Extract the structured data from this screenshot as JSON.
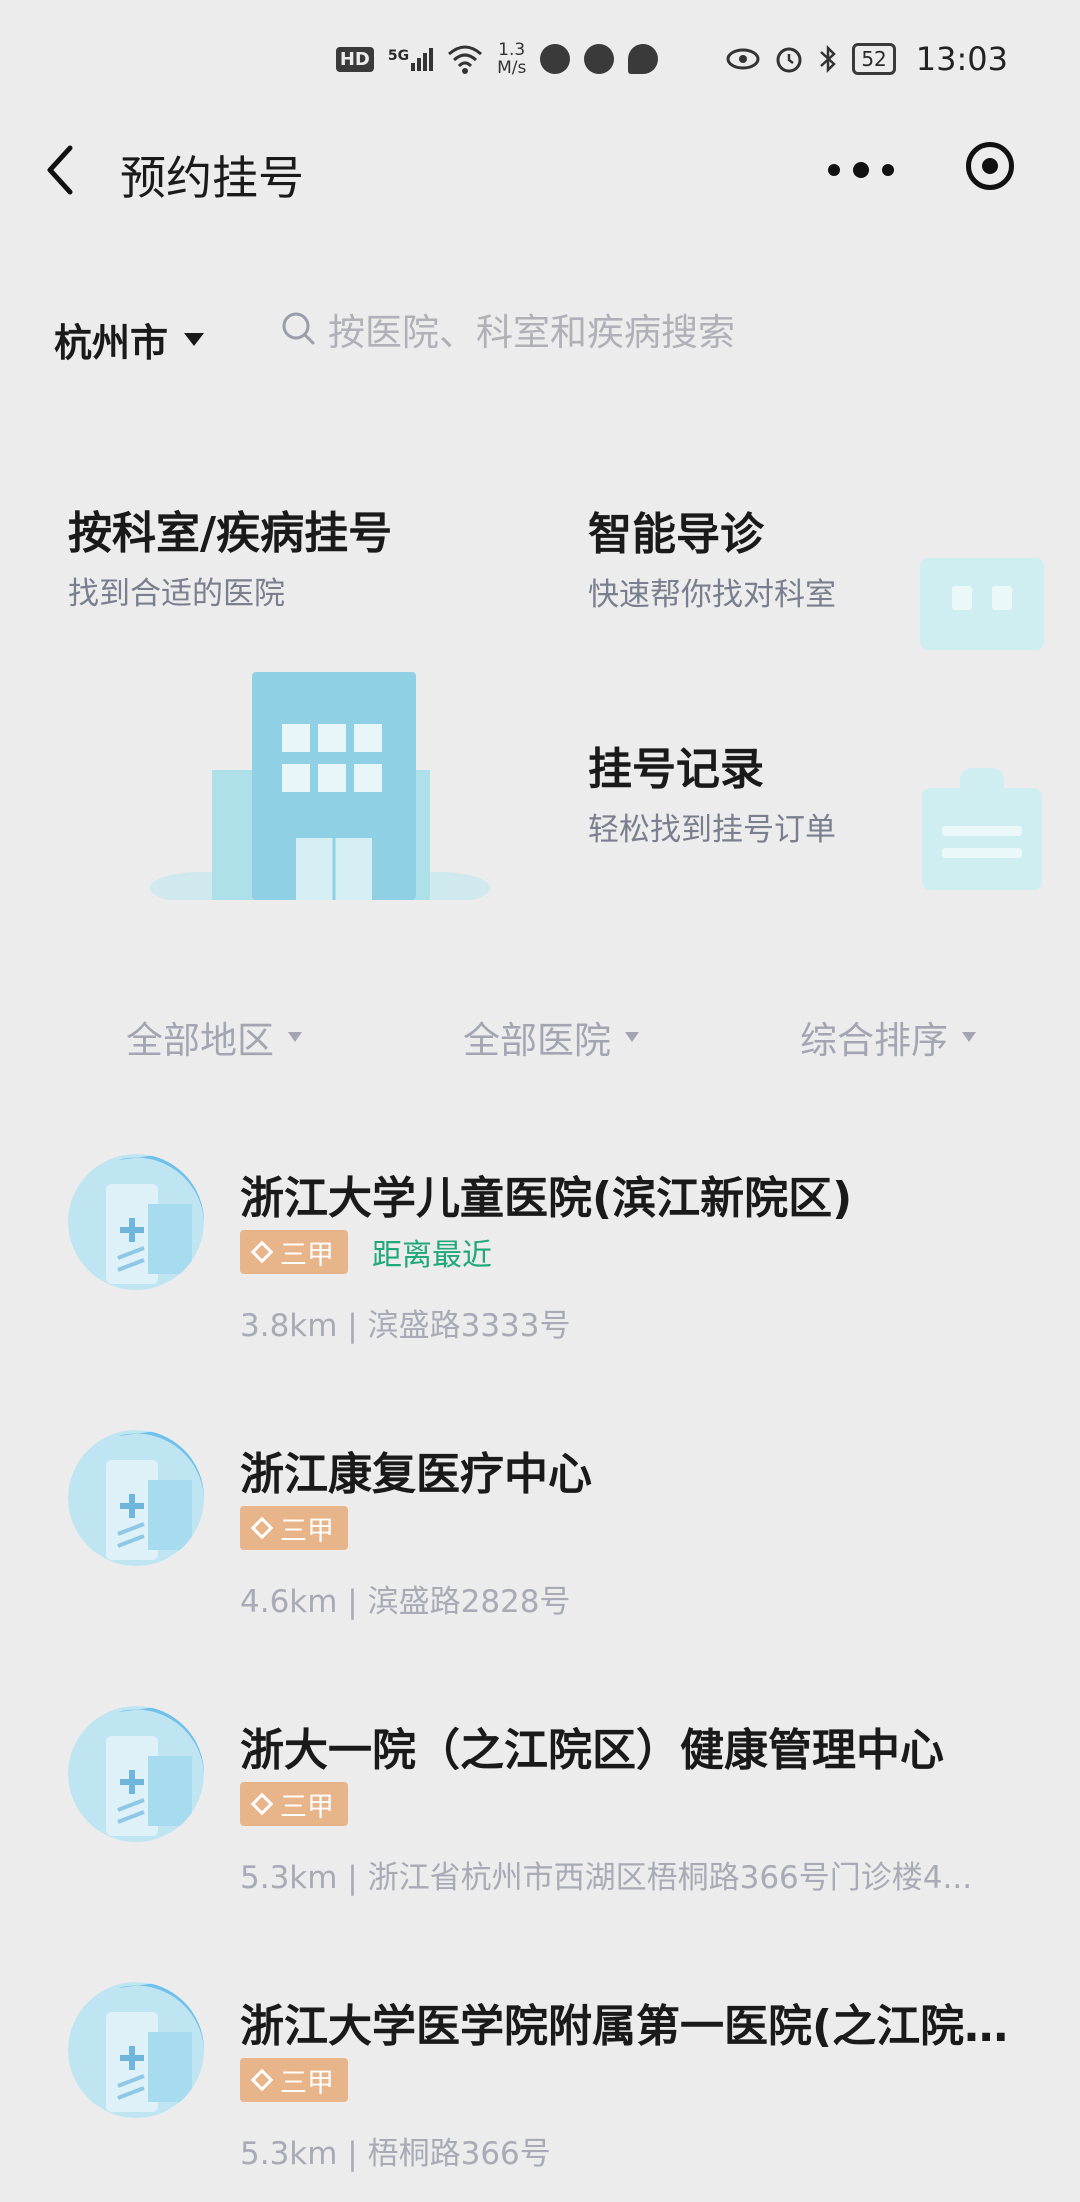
{
  "status_bar": {
    "hd": "HD",
    "network": "5G",
    "speed_value": "1.3",
    "speed_unit": "M/s",
    "battery": "52",
    "time": "13:03"
  },
  "header": {
    "title": "预约挂号"
  },
  "city": {
    "label": "杭州市"
  },
  "search": {
    "placeholder": "按医院、科室和疾病搜索"
  },
  "features": {
    "by_department": {
      "title": "按科室/疾病挂号",
      "subtitle": "找到合适的医院"
    },
    "smart_guide": {
      "title": "智能导诊",
      "subtitle": "快速帮你找对科室"
    },
    "records": {
      "title": "挂号记录",
      "subtitle": "轻松找到挂号订单"
    }
  },
  "filters": [
    {
      "label": "全部地区"
    },
    {
      "label": "全部医院"
    },
    {
      "label": "综合排序"
    }
  ],
  "hospitals": [
    {
      "name": "浙江大学儿童医院(滨江新院区)",
      "level": "三甲",
      "tag": "距离最近",
      "address": "3.8km | 滨盛路3333号"
    },
    {
      "name": "浙江康复医疗中心",
      "level": "三甲",
      "tag": "",
      "address": "4.6km | 滨盛路2828号"
    },
    {
      "name": "浙大一院（之江院区）健康管理中心",
      "level": "三甲",
      "tag": "",
      "address": "5.3km | 浙江省杭州市西湖区梧桐路366号门诊楼4..."
    },
    {
      "name": "浙江大学医学院附属第一医院(之江院...",
      "level": "三甲",
      "tag": "",
      "address": "5.3km | 梧桐路366号"
    }
  ],
  "colors": {
    "background": "#ececec",
    "badge": "#e8b48a",
    "nearest_tag": "#1fa97a",
    "muted_text": "#a8abb6"
  }
}
